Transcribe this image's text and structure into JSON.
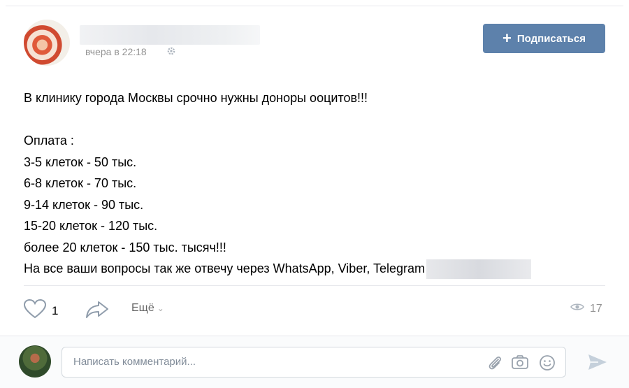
{
  "post": {
    "time": "вчера в 22:18",
    "subscribe_label": "Подписаться",
    "lines": [
      "В клинику города Москвы срочно нужны доноры ооцитов!!!",
      "",
      "Оплата :",
      "3-5 клеток - 50 тыс.",
      "6-8 клеток - 70 тыс.",
      "9-14 клеток - 90 тыс.",
      "15-20 клеток - 120 тыс.",
      "более 20 клеток - 150 тыс. тысяч!!!",
      "На все ваши вопросы так же отвечу через WhatsApp, Viber, Telegram"
    ]
  },
  "actions": {
    "like_count": "1",
    "more_label": "Ещё",
    "views_count": "17"
  },
  "comment": {
    "placeholder": "Написать комментарий..."
  },
  "icons": {
    "settings": "gear-icon",
    "like": "heart-icon",
    "share": "share-arrow-icon",
    "views": "eye-icon",
    "attach": "paperclip-icon",
    "photo": "camera-icon",
    "emoji": "smile-icon",
    "send": "send-icon"
  },
  "colors": {
    "accent": "#5d81ab",
    "muted": "#939393"
  }
}
